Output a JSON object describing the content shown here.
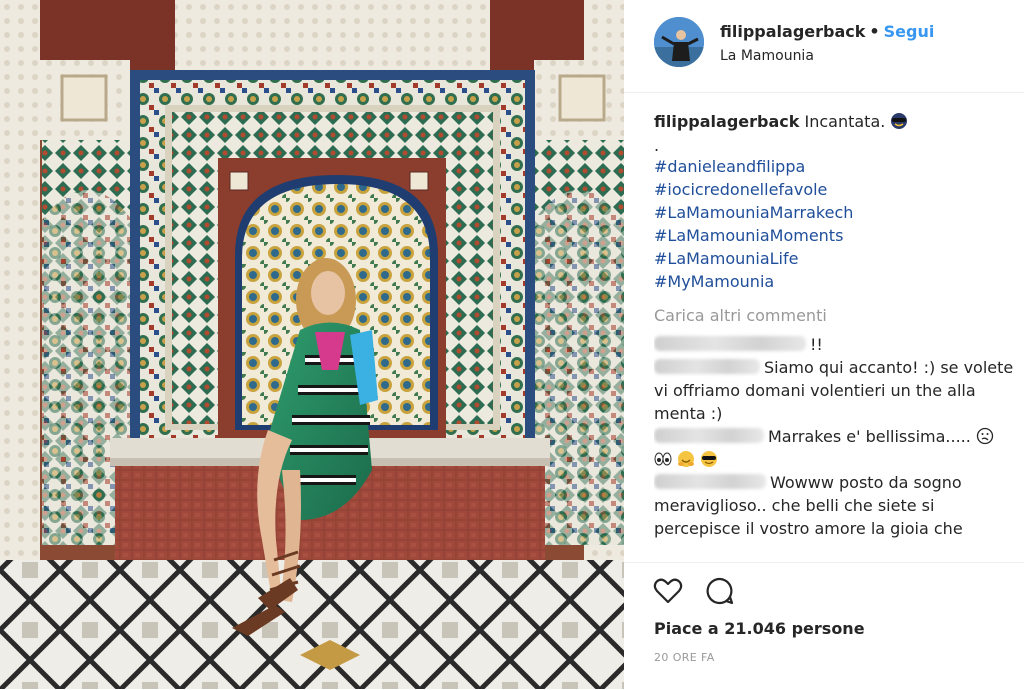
{
  "post": {
    "username": "filippalagerback",
    "separator": "•",
    "follow_label": "Segui",
    "location": "La Mamounia",
    "avatar_icon": "profile-photo"
  },
  "caption": {
    "username": "filippalagerback",
    "text": "Incantata.",
    "dot": ".",
    "hashtags": [
      "#danieleandfilippa",
      "#iocicredonellefavole",
      "#LaMamouniaMarrakech",
      "#LaMamouniaMoments",
      "#LaMamouniaLife",
      "#MyMamounia"
    ]
  },
  "load_more_label": "Carica altri commenti",
  "comments": [
    {
      "text": "!!"
    },
    {
      "text": "Siamo qui accanto! :) se volete vi offriamo domani volentieri un the alla menta :)"
    },
    {
      "text": "Marrakes e' bellissima.....",
      "emoji_line": true
    },
    {
      "text": "Wowww posto da sogno meraviglioso.. che belli che siete si percepisce il vostro amore la gioia che"
    }
  ],
  "actions": {
    "like_icon": "heart-icon",
    "comment_icon": "comment-icon"
  },
  "likes_text": "Piace a 21.046 persone",
  "time_text": "20 ORE FA",
  "colors": {
    "link": "#3897f0",
    "hashtag": "#1f4e9a",
    "muted": "#999999",
    "text": "#262626"
  }
}
